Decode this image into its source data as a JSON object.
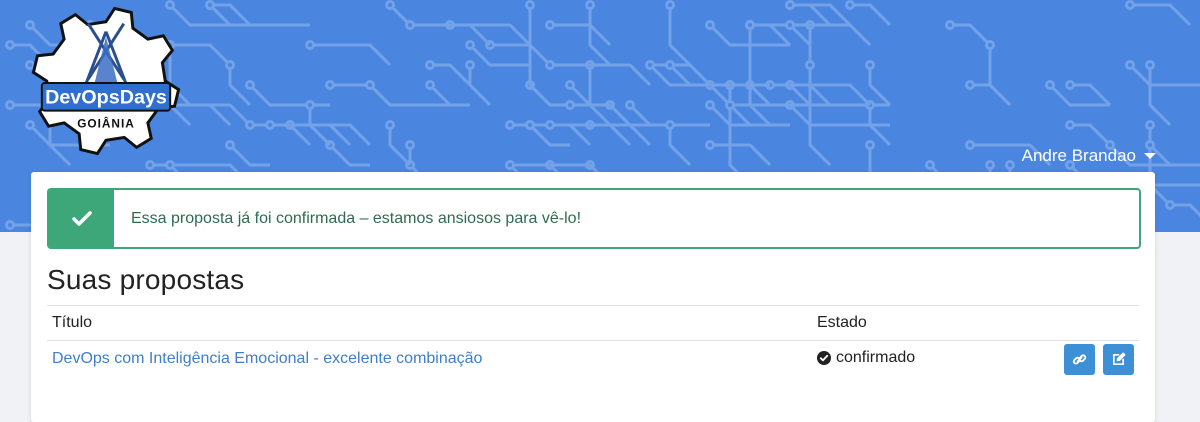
{
  "brand": {
    "logo_line1": "DevOpsDays",
    "logo_line2": "GOIÂNIA",
    "accent": "#4a86e0"
  },
  "user_menu": {
    "name": "Andre Brandao",
    "icon": "caret-down-icon"
  },
  "alert": {
    "icon": "check-icon",
    "message": "Essa proposta já foi confirmada – estamos ansiosos para vê-lo!",
    "color": "#3ea77a"
  },
  "proposals": {
    "heading": "Suas propostas",
    "columns": {
      "title": "Título",
      "status": "Estado"
    },
    "rows": [
      {
        "title": "DevOps com Inteligência Emocional - excelente combinação",
        "status": "confirmado",
        "status_icon": "check-circle-icon",
        "actions": [
          "link-icon",
          "edit-icon"
        ]
      }
    ]
  }
}
